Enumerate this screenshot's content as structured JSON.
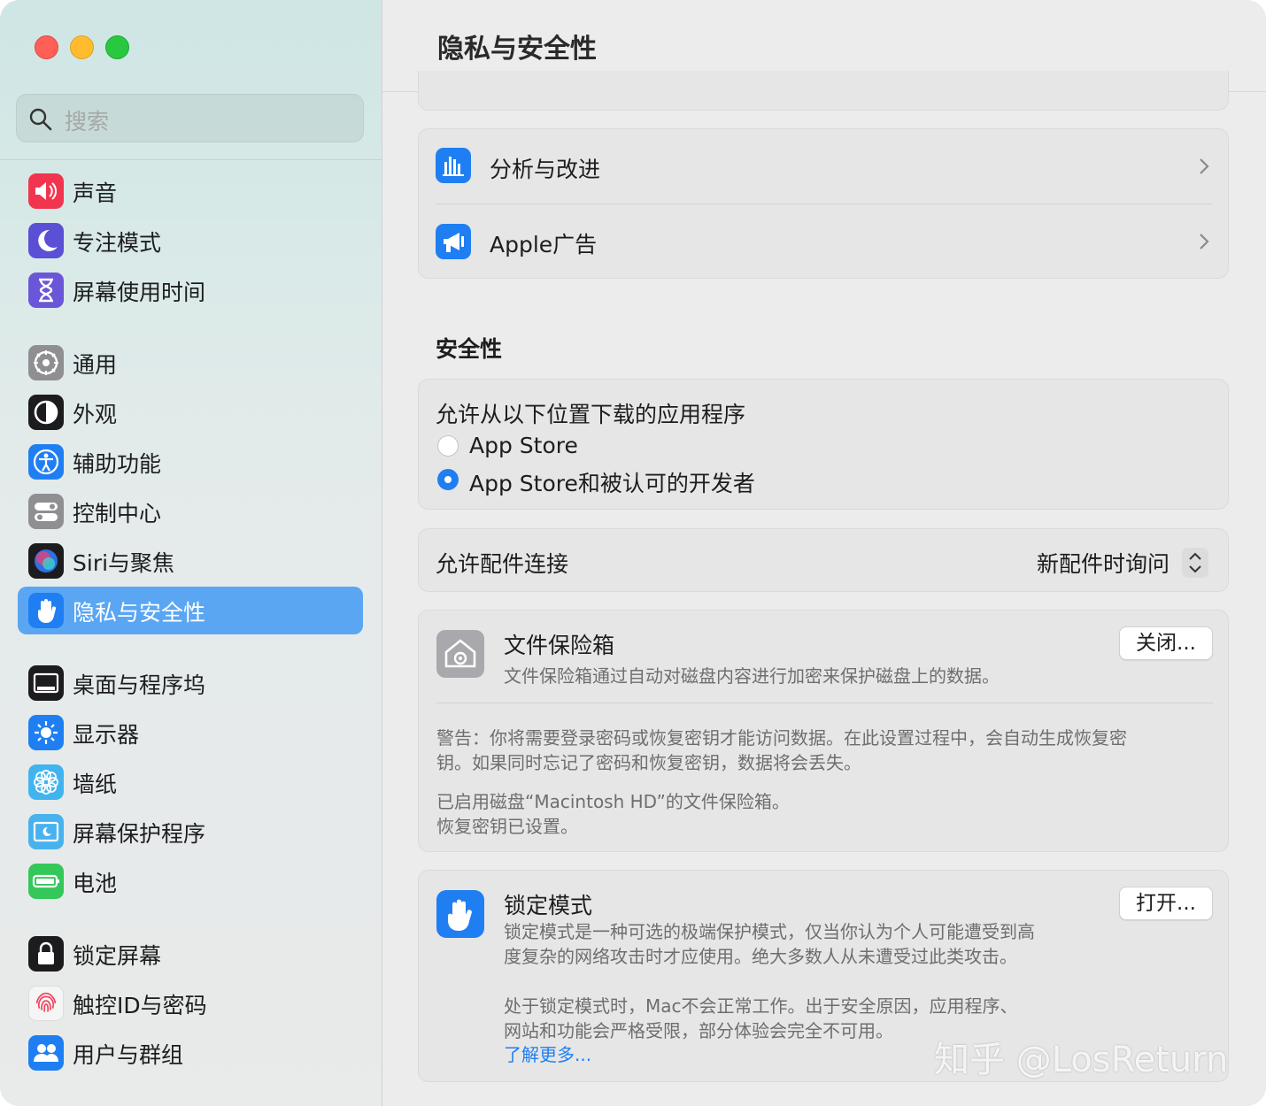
{
  "sidebar": {
    "search_placeholder": "搜索",
    "items": [
      {
        "label": "声音",
        "icon": "speaker-icon",
        "color": "#f2354f"
      },
      {
        "label": "专注模式",
        "icon": "moon-icon",
        "color": "#5b4fd6"
      },
      {
        "label": "屏幕使用时间",
        "icon": "hourglass-icon",
        "color": "#6a56d8"
      },
      {
        "label": "通用",
        "icon": "gear-icon",
        "color": "#8e8e93"
      },
      {
        "label": "外观",
        "icon": "appearance-icon",
        "color": "#1c1c1e"
      },
      {
        "label": "辅助功能",
        "icon": "accessibility-icon",
        "color": "#1f7ff2"
      },
      {
        "label": "控制中心",
        "icon": "toggles-icon",
        "color": "#8e8e93"
      },
      {
        "label": "Siri与聚焦",
        "icon": "siri-icon",
        "color": "#1c1c1e"
      },
      {
        "label": "隐私与安全性",
        "icon": "hand-icon",
        "color": "#1f7ff2",
        "active": true
      },
      {
        "label": "桌面与程序坞",
        "icon": "dock-icon",
        "color": "#1c1c1e"
      },
      {
        "label": "显示器",
        "icon": "sun-icon",
        "color": "#1f7ff2"
      },
      {
        "label": "墙纸",
        "icon": "flower-icon",
        "color": "#41b4f0"
      },
      {
        "label": "屏幕保护程序",
        "icon": "screensaver-icon",
        "color": "#47b2ee"
      },
      {
        "label": "电池",
        "icon": "battery-icon",
        "color": "#34c759"
      },
      {
        "label": "锁定屏幕",
        "icon": "lock-icon",
        "color": "#1c1c1e"
      },
      {
        "label": "触控ID与密码",
        "icon": "fingerprint-icon",
        "color": "#f5f5f5"
      },
      {
        "label": "用户与群组",
        "icon": "users-icon",
        "color": "#1f7ff2"
      }
    ]
  },
  "header": {
    "title": "隐私与安全性"
  },
  "privacy_rows": [
    {
      "label": "分析与改进",
      "icon": "chart-bars-icon"
    },
    {
      "label": "Apple广告",
      "icon": "megaphone-icon"
    }
  ],
  "security": {
    "section_title": "安全性",
    "download": {
      "title": "允许从以下位置下载的应用程序",
      "options": [
        {
          "label": "App Store",
          "selected": false
        },
        {
          "label": "App Store和被认可的开发者",
          "selected": true
        }
      ]
    },
    "accessory": {
      "label": "允许配件连接",
      "value": "新配件时询问"
    },
    "filevault": {
      "title": "文件保险箱",
      "description": "文件保险箱通过自动对磁盘内容进行加密来保护磁盘上的数据。",
      "button": "关闭...",
      "warning_line1": "警告：你将需要登录密码或恢复密钥才能访问数据。在此设置过程中，会自动生成恢复密",
      "warning_line2": "钥。如果同时忘记了密码和恢复密钥，数据将会丢失。",
      "status_line1": "已启用磁盘“Macintosh HD”的文件保险箱。",
      "status_line2": "恢复密钥已设置。"
    },
    "lockdown": {
      "title": "锁定模式",
      "button": "打开...",
      "desc_line1": "锁定模式是一种可选的极端保护模式，仅当你认为个人可能遭受到高",
      "desc_line2": "度复杂的网络攻击时才应使用。绝大多数人从未遭受过此类攻击。",
      "note_line1": "处于锁定模式时，Mac不会正常工作。出于安全原因，应用程序、",
      "note_line2": "网站和功能会严格受限，部分体验会完全不可用。",
      "learn_more": "了解更多..."
    }
  },
  "watermark": "知乎 @LosReturn"
}
